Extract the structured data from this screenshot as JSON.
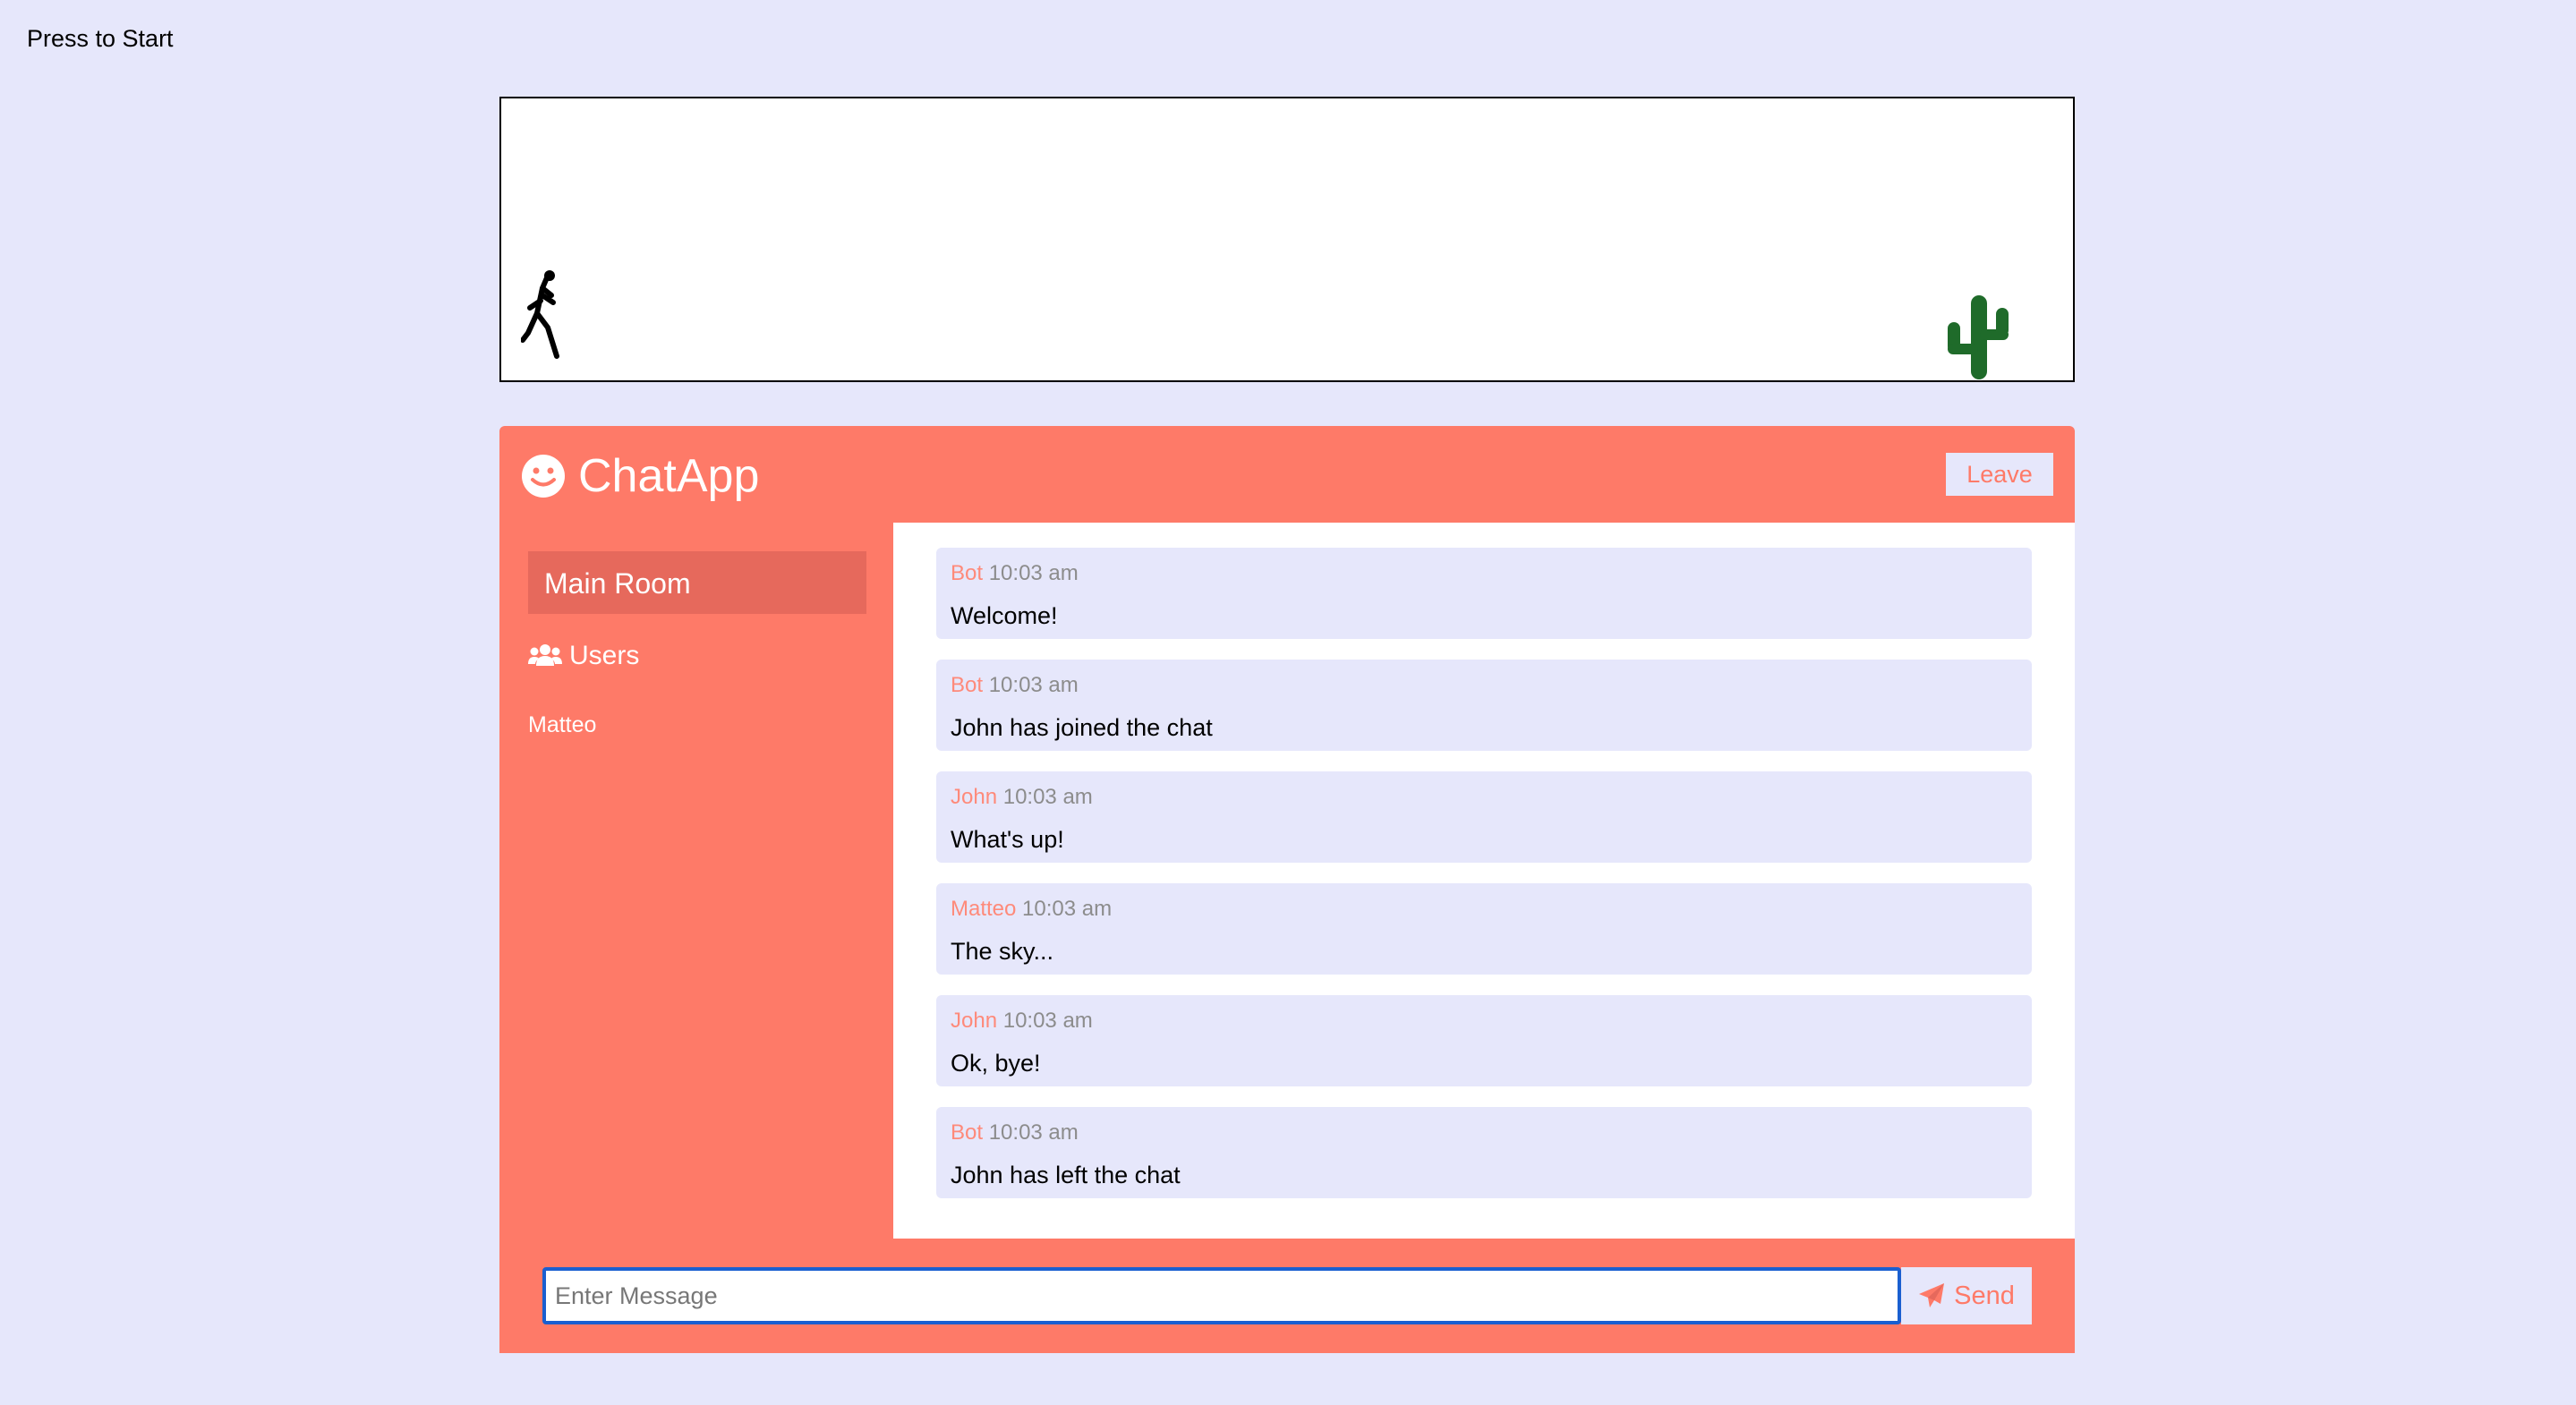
{
  "game": {
    "start_prompt": "Press to Start",
    "player_icon": "runner-icon",
    "obstacle_icon": "cactus-icon"
  },
  "chat": {
    "app_title": "ChatApp",
    "brand_icon": "smile-icon",
    "leave_label": "Leave",
    "room_name": "Main Room",
    "users_heading": "Users",
    "users_icon": "users-icon",
    "users": [
      "Matteo"
    ],
    "messages": [
      {
        "author": "Bot",
        "time": "10:03 am",
        "text": "Welcome!"
      },
      {
        "author": "Bot",
        "time": "10:03 am",
        "text": "John has joined the chat"
      },
      {
        "author": "John",
        "time": "10:03 am",
        "text": "What's up!"
      },
      {
        "author": "Matteo",
        "time": "10:03 am",
        "text": "The sky..."
      },
      {
        "author": "John",
        "time": "10:03 am",
        "text": "Ok, bye!"
      },
      {
        "author": "Bot",
        "time": "10:03 am",
        "text": "John has left the chat"
      }
    ],
    "input_placeholder": "Enter Message",
    "input_value": "",
    "send_label": "Send",
    "send_icon": "paper-plane-icon"
  },
  "colors": {
    "page_background": "#e6e7fb",
    "chat_accent": "#fe7a68",
    "room_highlight": "#e6695c",
    "author_name": "#fe8a7a",
    "cactus": "#1f6b2a",
    "input_focus_border": "#1a5fd0"
  }
}
